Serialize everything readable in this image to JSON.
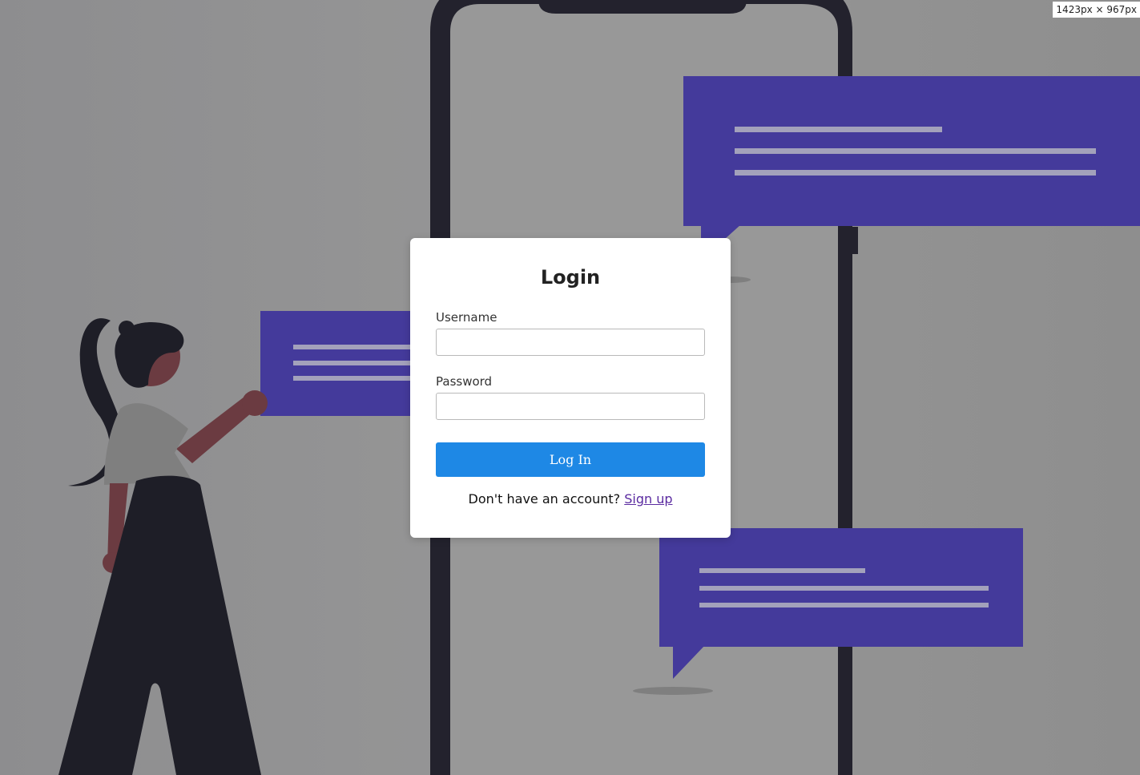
{
  "viewport_badge": "1423px × 967px",
  "login": {
    "title": "Login",
    "username_label": "Username",
    "username_value": "",
    "password_label": "Password",
    "password_value": "",
    "submit_label": "Log In",
    "signup_prompt": "Don't have an account?",
    "signup_link": "Sign up"
  },
  "colors": {
    "background": "#8f8f8f",
    "phone_frame": "#23222d",
    "speech_bubble": "#443a9b",
    "primary_button": "#1e88e5",
    "link": "#5a2aa0"
  },
  "illustration_icons": [
    "phone-illustration-icon",
    "speech-bubble-icon",
    "woman-figure-icon"
  ]
}
